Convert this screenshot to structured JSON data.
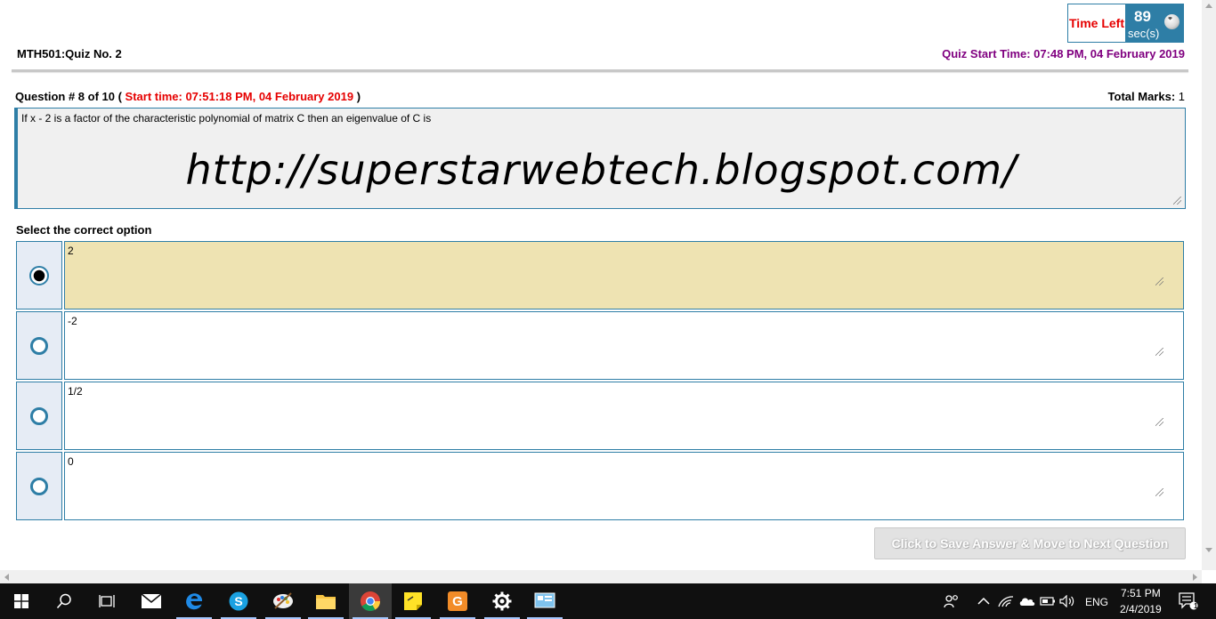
{
  "timer": {
    "label": "Time Left",
    "value": "89",
    "unit": "sec(s)"
  },
  "quiz": {
    "title": "MTH501:Quiz No. 2",
    "start_time": "Quiz Start Time: 07:48 PM, 04 February 2019"
  },
  "question": {
    "heading": "Question # 8 of 10 (",
    "start_time": "Start time: 07:51:18 PM, 04 February 2019",
    "heading_end": ")",
    "total_marks_label": "Total Marks:",
    "total_marks_value": " 1",
    "text": "If x - 2 is a factor of the characteristic polynomial of matrix C then an eigenvalue of C is",
    "watermark": "http://superstarwebtech.blogspot.com/"
  },
  "options": {
    "label": "Select the correct option",
    "items": [
      {
        "text": "2",
        "selected": true
      },
      {
        "text": "-2",
        "selected": false
      },
      {
        "text": "1/2",
        "selected": false
      },
      {
        "text": "0",
        "selected": false
      }
    ]
  },
  "next_button": {
    "label": "Click to Save Answer & Move to Next Question"
  },
  "taskbar": {
    "icons": [
      "windows-start-icon",
      "search-icon",
      "task-view-icon",
      "mail-icon",
      "edge-icon",
      "skype-icon",
      "paint-icon",
      "file-explorer-icon",
      "chrome-icon",
      "sticky-notes-icon",
      "app-g-icon",
      "settings-icon",
      "control-panel-icon"
    ],
    "language": "ENG",
    "time": "7:51 PM",
    "date": "2/4/2019",
    "notification_count": "1"
  },
  "colors": {
    "accent": "#2e7ea6",
    "red": "#e60000",
    "purple": "#800080",
    "selected_option": "#eee3b2"
  }
}
